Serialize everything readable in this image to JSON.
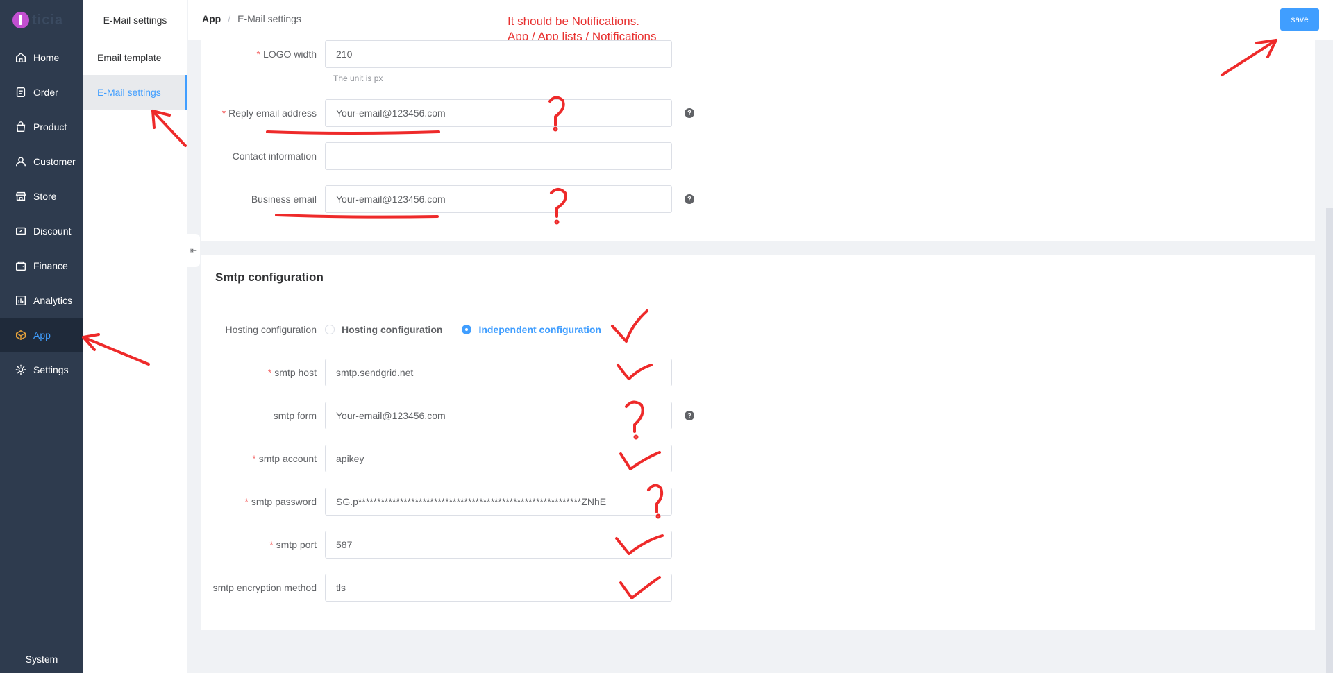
{
  "logo_text": "ticia",
  "nav": {
    "items": [
      {
        "label": "Home",
        "icon": "home-icon"
      },
      {
        "label": "Order",
        "icon": "order-icon"
      },
      {
        "label": "Product",
        "icon": "product-icon"
      },
      {
        "label": "Customer",
        "icon": "customer-icon"
      },
      {
        "label": "Store",
        "icon": "store-icon"
      },
      {
        "label": "Discount",
        "icon": "discount-icon"
      },
      {
        "label": "Finance",
        "icon": "finance-icon"
      },
      {
        "label": "Analytics",
        "icon": "analytics-icon"
      },
      {
        "label": "App",
        "icon": "app-cube-icon"
      },
      {
        "label": "Settings",
        "icon": "settings-gear-icon"
      }
    ],
    "active": "App",
    "system": "System"
  },
  "subnav": {
    "title": "E-Mail settings",
    "items": [
      "Email template",
      "E-Mail settings"
    ],
    "active": "E-Mail settings"
  },
  "breadcrumb": {
    "root": "App",
    "separator": "/",
    "current": "E-Mail settings"
  },
  "annotation": {
    "line1": "It should be Notifications.",
    "line2": "App / App lists / Notifications",
    "color": "#e8302f"
  },
  "save_label": "save",
  "general": {
    "logo_width": {
      "label": "LOGO width",
      "value": "210",
      "hint": "The unit is px"
    },
    "reply_email": {
      "label": "Reply email address",
      "value": "Your-email@123456.com"
    },
    "contact": {
      "label": "Contact information",
      "value": ""
    },
    "business_email": {
      "label": "Business email",
      "value": "Your-email@123456.com"
    }
  },
  "smtp": {
    "title": "Smtp configuration",
    "hosting": {
      "label": "Hosting configuration",
      "options": [
        "Hosting configuration",
        "Independent configuration"
      ],
      "selected": "Independent configuration"
    },
    "host": {
      "label": "smtp host",
      "value": "smtp.sendgrid.net"
    },
    "form": {
      "label": "smtp form",
      "value": "Your-email@123456.com"
    },
    "account": {
      "label": "smtp account",
      "value": "apikey"
    },
    "password": {
      "label": "smtp password",
      "value": "SG.p***********************************************************ZNhE"
    },
    "port": {
      "label": "smtp port",
      "value": "587"
    },
    "encryption": {
      "label": "smtp encryption method",
      "value": "tls"
    }
  },
  "colors": {
    "primary": "#409eff",
    "nav_bg": "#2e3b4e",
    "required": "#f56c6c"
  }
}
